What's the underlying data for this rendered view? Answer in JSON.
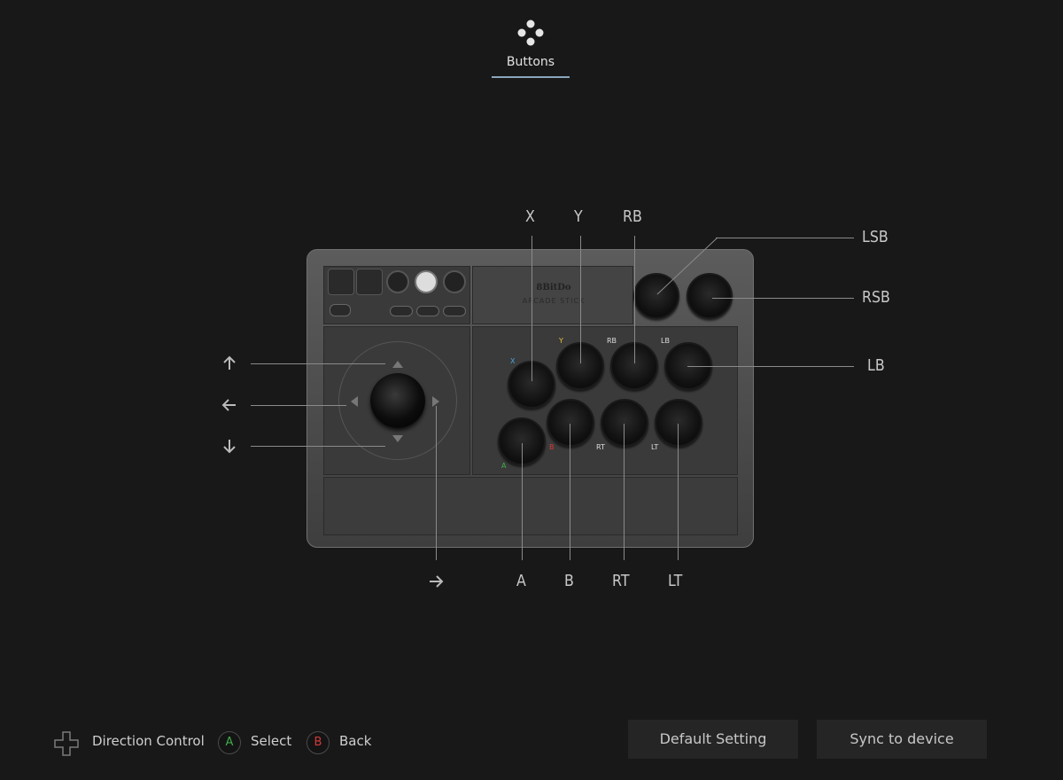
{
  "tab": {
    "label": "Buttons"
  },
  "device": {
    "brand": "8BitDo",
    "model": "ARCADE STICK"
  },
  "mapping": {
    "top": [
      "X",
      "Y",
      "RB"
    ],
    "bottom": [
      "A",
      "B",
      "RT",
      "LT"
    ],
    "right": [
      "LSB",
      "RSB",
      "LB"
    ]
  },
  "button_prints": {
    "x": "X",
    "y": "Y",
    "rb": "RB",
    "lb": "LB",
    "a": "A",
    "b": "B",
    "rt": "RT",
    "lt": "LT"
  },
  "footer": {
    "direction_label": "Direction Control",
    "select_glyph": "A",
    "select_label": "Select",
    "back_glyph": "B",
    "back_label": "Back",
    "default_setting": "Default Setting",
    "sync": "Sync to device"
  },
  "colors": {
    "accent_underline": "#8aa6bd",
    "a_green": "#3fae4a",
    "b_red": "#d23a3a",
    "x_blue": "#4aa3d8",
    "y_yellow": "#e0c23a"
  }
}
